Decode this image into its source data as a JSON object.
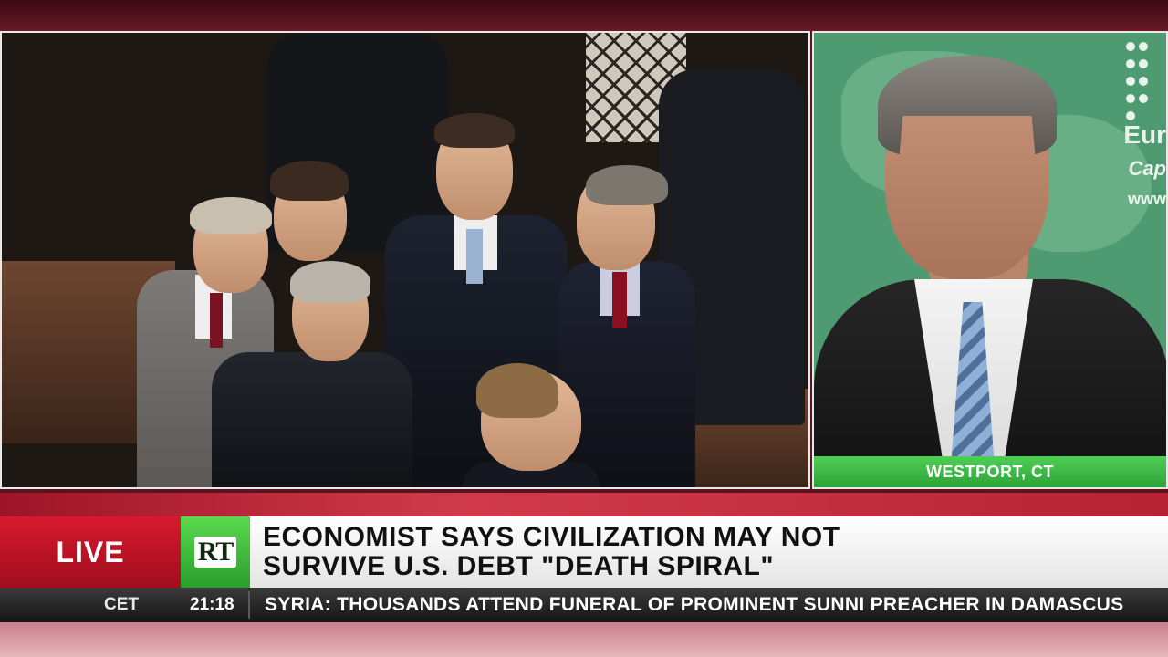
{
  "left_feed": {
    "description_name": "congress-floor-footage"
  },
  "right_feed": {
    "logo_lines": [
      "Eur",
      "Cap",
      "www"
    ],
    "location": "WESTPORT, CT"
  },
  "lower_third": {
    "live_label": "LIVE",
    "channel_logo": "RT",
    "headline_line1": "ECONOMIST SAYS CIVILIZATION MAY NOT",
    "headline_line2": "SURVIVE U.S. DEBT \"DEATH SPIRAL\""
  },
  "ticker": {
    "timezone": "CET",
    "time": "21:18",
    "text": "SYRIA: THOUSANDS ATTEND FUNERAL OF PROMINENT SUNNI PREACHER IN DAMASCUS"
  },
  "colors": {
    "live_red": "#d8192e",
    "rt_green": "#3fbf3f",
    "location_green": "#3ab944"
  }
}
